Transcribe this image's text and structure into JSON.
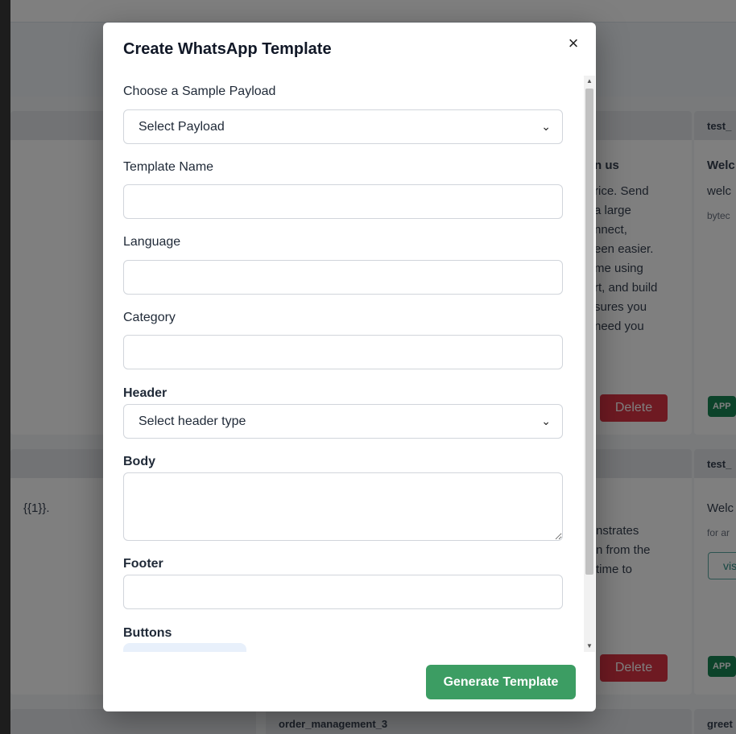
{
  "background": {
    "cards": {
      "col3_top": {
        "title_fragment": "n us",
        "lines": [
          "rice. Send",
          "a large",
          "nnect,",
          "een easier.",
          "me using",
          "rt, and build",
          "sures you",
          "need you"
        ],
        "delete_label": "Delete"
      },
      "col4_top": {
        "header": "test_",
        "title": "Welc",
        "body": "welc",
        "small": "bytec",
        "badge": "APP"
      },
      "col1_mid": {
        "placeholder_text": "{{1}}."
      },
      "col3_mid": {
        "lines": [
          "nstrates",
          "n from the",
          "time to"
        ],
        "delete_label": "Delete"
      },
      "col4_mid": {
        "header": "test_",
        "title": "Welc",
        "small": "for ar",
        "visit_label": "vis",
        "badge": "APP"
      },
      "col3_bottom": {
        "header": "order_management_3"
      },
      "col4_bottom": {
        "header": "greet"
      }
    }
  },
  "modal": {
    "title": "Create WhatsApp Template",
    "close_symbol": "×",
    "payload": {
      "label": "Choose a Sample Payload",
      "selected": "Select Payload"
    },
    "template_name": {
      "label": "Template Name",
      "value": ""
    },
    "language": {
      "label": "Language",
      "value": ""
    },
    "category": {
      "label": "Category",
      "value": ""
    },
    "header": {
      "label": "Header",
      "selected": "Select header type"
    },
    "body": {
      "label": "Body",
      "value": ""
    },
    "footer": {
      "label": "Footer",
      "value": ""
    },
    "buttons": {
      "label": "Buttons"
    },
    "generate_label": "Generate Template"
  }
}
